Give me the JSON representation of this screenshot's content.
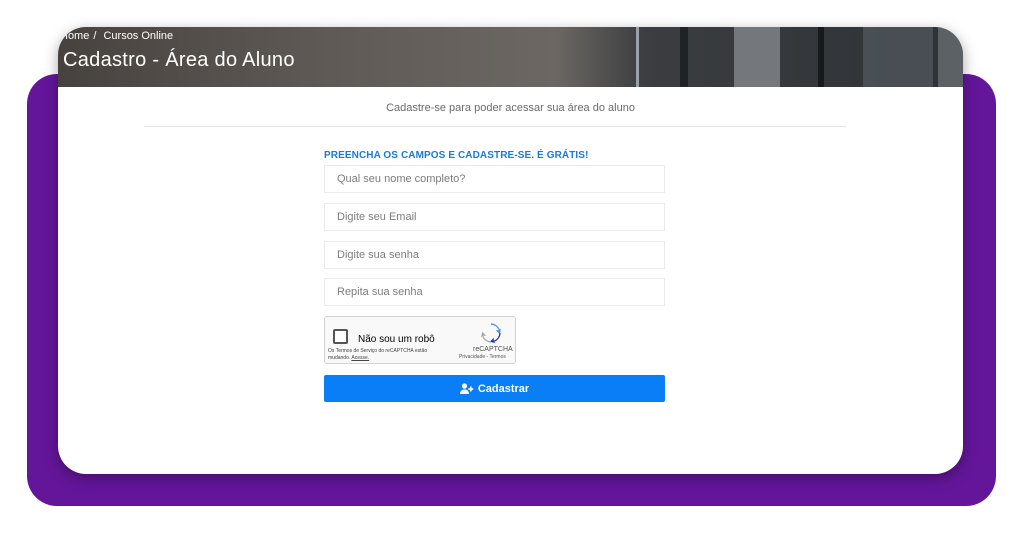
{
  "breadcrumb": {
    "home": "Home",
    "separator": "/",
    "current": "Cursos Online"
  },
  "hero": {
    "title": "Cadastro - Área do Aluno"
  },
  "subtitle": "Cadastre-se para poder acessar sua área do aluno",
  "form": {
    "heading": "PREENCHA OS CAMPOS E CADASTRE-SE. É GRÁTIS!",
    "fields": [
      {
        "placeholder": "Qual seu nome completo?",
        "value": ""
      },
      {
        "placeholder": "Digite seu Email",
        "value": ""
      },
      {
        "placeholder": "Digite sua senha",
        "value": ""
      },
      {
        "placeholder": "Repita sua senha",
        "value": ""
      }
    ],
    "recaptcha": {
      "label": "Não sou um robô",
      "terms": "Os Termos de Serviço do reCAPTCHA estão mudando.",
      "terms_link": "Acesse.",
      "brand": "reCAPTCHA",
      "links": "Privacidade - Termos"
    },
    "submit_label": "Cadastrar",
    "submit_icon": "user-plus-icon"
  },
  "colors": {
    "accent": "#0a7ff5",
    "heading": "#1a7ad8",
    "background_frame": "#64169b"
  }
}
